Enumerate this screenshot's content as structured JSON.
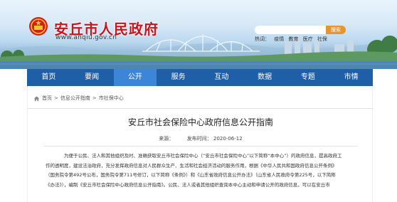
{
  "site": {
    "title": "安丘市人民政府",
    "url": "www.anqiu.gov.cn"
  },
  "search": {
    "placeholder": "",
    "button_label": "搜索",
    "hot_label": "热词：",
    "hot_words": [
      "疫情",
      "教育",
      "医疗",
      "社保"
    ]
  },
  "nav": {
    "items": [
      "首页",
      "要闻",
      "公开",
      "服务",
      "互动",
      "数据",
      "专题",
      "市情"
    ],
    "active_index": 2
  },
  "breadcrumb": {
    "items": [
      "首页",
      "信息公开指南",
      "市社保中心"
    ],
    "separator": ">"
  },
  "article": {
    "title": "安丘市社会保险中心政府信息公开指南",
    "source_label": "来源：",
    "source_value": "",
    "date_label": "发布时间：",
    "date_value": "2020-06-12",
    "lines": [
      "为便于公民、法人和其他组织及时、准确获取安丘市社会保险中心（“安丘市社会保险中心”以下简称“本中心”）的政府信息，提高政府工",
      "作的透明度，建设法治政府，充分发挥政府信息对人民群众生产、生活和社会经济活动的服务作用，根据《中华人民共和国政府信息公开条例》",
      "（国务院令第492号公布，国务院令第711号修订，以下简称《条例》）和《山东省政府信息公开办法》（山东省人民政府令第225号，以下简称",
      "《办法》），编制《安丘市社会保险中心政府信息公开指南》。公民、法人或者其他组织查询本中心主动和申请公开的政府信息，可以在安丘市"
    ]
  },
  "colors": {
    "nav_bg": "#1f5fa8",
    "nav_active": "#3b86d6",
    "title_red": "#c8161d",
    "search_orange": "#e8962a"
  }
}
